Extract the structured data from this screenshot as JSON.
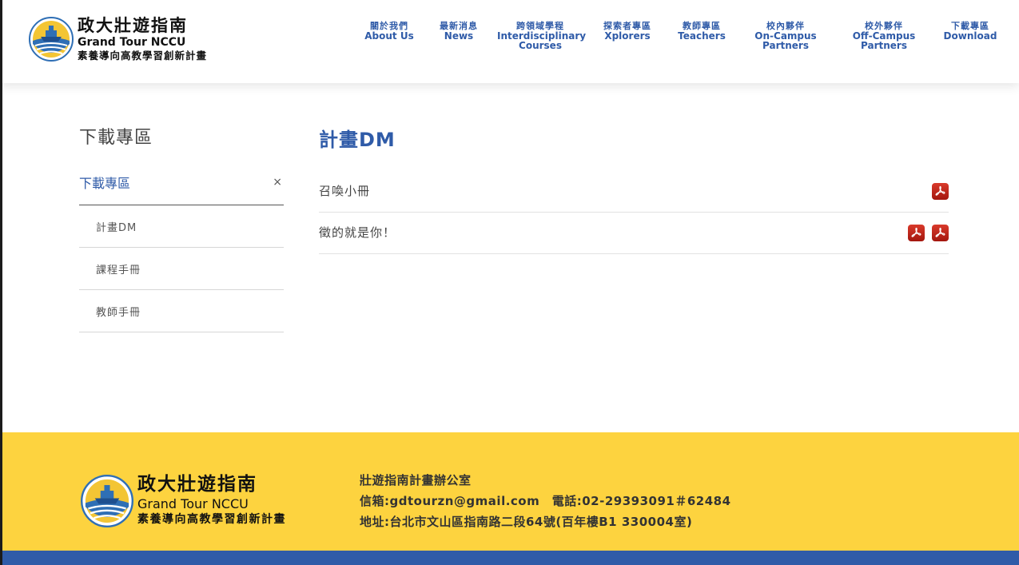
{
  "site": {
    "name_zh": "政大壯遊指南",
    "name_en": "Grand Tour NCCU",
    "subtitle": "素養導向高教學習創新計畫"
  },
  "nav": [
    {
      "zh": "關於我們",
      "en": [
        "About Us"
      ]
    },
    {
      "zh": "最新消息",
      "en": [
        "News"
      ]
    },
    {
      "zh": "跨領域學程",
      "en": [
        "Interdisciplinary",
        "Courses"
      ]
    },
    {
      "zh": "探索者專區",
      "en": [
        "Xplorers"
      ]
    },
    {
      "zh": "教師專區",
      "en": [
        "Teachers"
      ]
    },
    {
      "zh": "校內夥伴",
      "en": [
        "On-Campus",
        "Partners"
      ]
    },
    {
      "zh": "校外夥伴",
      "en": [
        "Off-Campus",
        "Partners"
      ]
    },
    {
      "zh": "下載專區",
      "en": [
        "Download"
      ]
    }
  ],
  "sidebar": {
    "title": "下載專區",
    "group_label": "下載專區",
    "collapse_icon": "×",
    "items": [
      {
        "label": "計畫DM",
        "active": true
      },
      {
        "label": "課程手冊",
        "active": false
      },
      {
        "label": "教師手冊",
        "active": false
      }
    ]
  },
  "main": {
    "title": "計畫DM",
    "documents": [
      {
        "name": "召喚小冊",
        "files": [
          "pdf-icon"
        ]
      },
      {
        "name": "徵的就是你！",
        "files": [
          "pdf-icon",
          "pdf-icon"
        ]
      }
    ]
  },
  "footer": {
    "office": "壯遊指南計畫辦公室",
    "contact": "信箱:gdtourzn@gmail.com　電話:02-29393091＃62484",
    "address": "地址:台北市文山區指南路二段64號(百年樓B1 330004室)"
  },
  "colors": {
    "brand_blue": "#2f5ba8",
    "footer_yellow": "#fdd33f",
    "pdf_red": "#c1221a"
  }
}
